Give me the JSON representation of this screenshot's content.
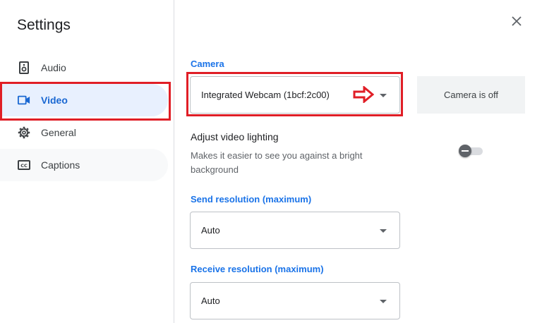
{
  "dialog": {
    "title": "Settings",
    "close_icon": "close-icon"
  },
  "sidebar": {
    "items": [
      {
        "label": "Audio",
        "icon": "speaker-icon",
        "active": false
      },
      {
        "label": "Video",
        "icon": "video-camera-icon",
        "active": true
      },
      {
        "label": "General",
        "icon": "gear-icon",
        "active": false
      },
      {
        "label": "Captions",
        "icon": "closed-captions-icon",
        "active": false
      }
    ]
  },
  "video": {
    "camera": {
      "label": "Camera",
      "value": "Integrated Webcam (1bcf:2c00)",
      "preview_status": "Camera is off"
    },
    "lighting": {
      "heading": "Adjust video lighting",
      "description": "Makes it easier to see you against a bright background",
      "enabled": false
    },
    "send_resolution": {
      "label": "Send resolution (maximum)",
      "value": "Auto"
    },
    "receive_resolution": {
      "label": "Receive resolution (maximum)",
      "value": "Auto"
    }
  },
  "colors": {
    "accent": "#1a73e8",
    "active_bg": "#e8f0fe",
    "highlight": "#e01e26"
  }
}
